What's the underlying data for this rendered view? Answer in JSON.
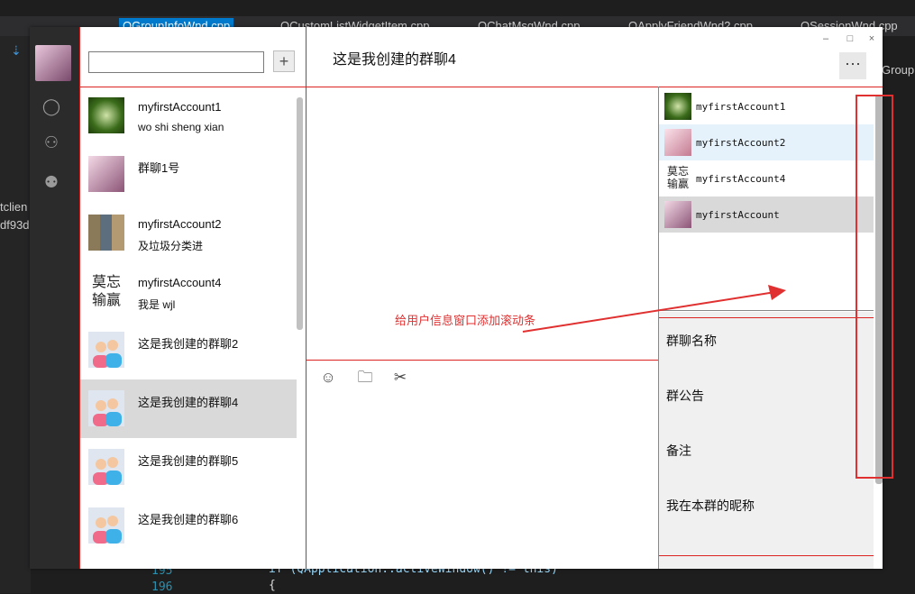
{
  "ide": {
    "tabs": [
      {
        "label": "QGroupInfoWnd.cpp",
        "active": true
      },
      {
        "label": "QCustomListWidgetItem.cpp",
        "active": false
      },
      {
        "label": "QChatMsgWnd.cpp",
        "active": false
      },
      {
        "label": "QApplyFriendWnd2.cpp",
        "active": false
      },
      {
        "label": "QSessionWnd.cpp",
        "active": false
      }
    ],
    "side_text_1": "tclien",
    "side_text_2": "df93d",
    "right_text": "Group",
    "line_195": "195",
    "line_196": "196",
    "code_195": "if (QApplication::activeWindow() != this)",
    "code_196": "{"
  },
  "app": {
    "nav_icons": [
      "chat-icon",
      "contacts-icon",
      "group-icon"
    ],
    "add_button": "+",
    "chat_title": "这是我创建的群聊4",
    "more_button": "···",
    "window_controls": {
      "minimize": "–",
      "maximize": "□",
      "close": "×"
    },
    "conversations": [
      {
        "name": "myfirstAccount1",
        "message": "wo shi sheng xian",
        "avatar": "green-avatar",
        "selected": false
      },
      {
        "name": "群聊1号",
        "message": "",
        "avatar": "anime-avatar",
        "selected": false
      },
      {
        "name": "myfirstAccount2",
        "message": "及垃圾分类进",
        "avatar": "grid-avatar",
        "selected": false
      },
      {
        "name": "myfirstAccount4",
        "message": "我是 wjl",
        "avatar": "calligraphy-avatar",
        "selected": false
      },
      {
        "name": "这是我创建的群聊2",
        "message": "",
        "avatar": "group-avatar",
        "selected": false
      },
      {
        "name": "这是我创建的群聊4",
        "message": "",
        "avatar": "group-avatar",
        "selected": true
      },
      {
        "name": "这是我创建的群聊5",
        "message": "",
        "avatar": "group-avatar",
        "selected": false
      },
      {
        "name": "这是我创建的群聊6",
        "message": "",
        "avatar": "group-avatar",
        "selected": false
      }
    ],
    "toolbar_icons": [
      "emoji-icon",
      "folder-icon",
      "scissors-icon"
    ],
    "members": [
      {
        "name": "myfirstAccount1",
        "avatar": "green-avatar",
        "state": "normal"
      },
      {
        "name": "myfirstAccount2",
        "avatar": "pink-avatar",
        "state": "hover"
      },
      {
        "name": "myfirstAccount4",
        "avatar": "calligraphy-avatar",
        "state": "normal"
      },
      {
        "name": "myfirstAccount",
        "avatar": "anime-avatar",
        "state": "selected"
      }
    ],
    "group_info": {
      "name_label": "群聊名称",
      "notice_label": "群公告",
      "remark_label": "备注",
      "nickname_label": "我在本群的昵称"
    },
    "annotation": "给用户信息窗口添加滚动条"
  },
  "colors": {
    "annotation_red": "#e03030",
    "nav_bg": "#2b2b2b",
    "selected_bg": "#d9d9d9",
    "hover_bg": "#e5f1fb",
    "info_bg": "#f0f0f0",
    "ide_accent": "#007acc"
  }
}
